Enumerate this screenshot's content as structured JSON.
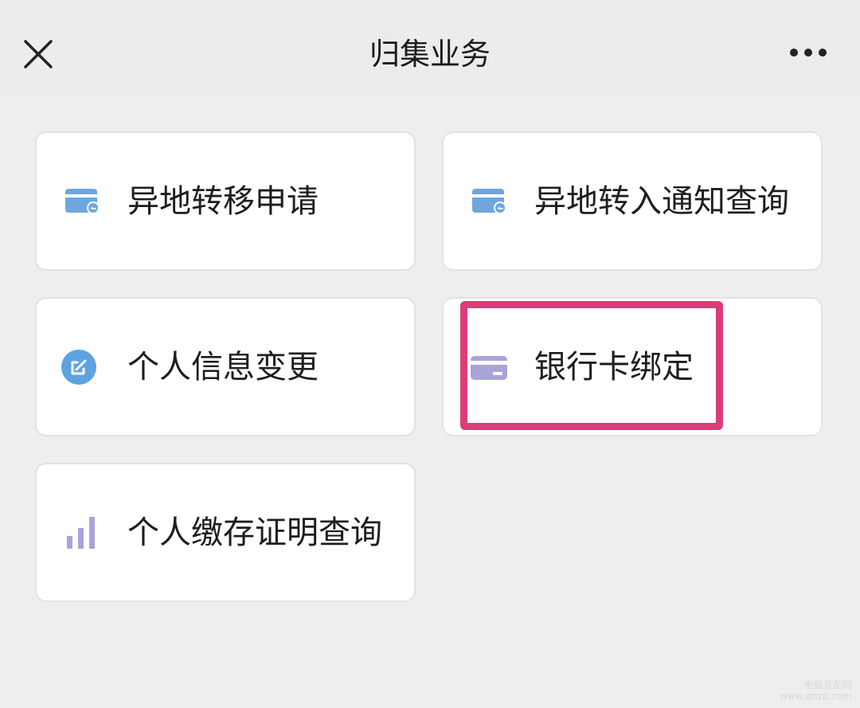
{
  "header": {
    "title": "归集业务",
    "close_icon": "close-icon",
    "more_icon": "more-dots-icon"
  },
  "services": [
    {
      "label": "异地转移申请",
      "icon": "card-transfer-icon",
      "icon_color": "#6fa6dc"
    },
    {
      "label": "异地转入通知查询",
      "icon": "card-transfer-icon",
      "icon_color": "#6fa6dc"
    },
    {
      "label": "个人信息变更",
      "icon": "edit-circle-icon",
      "icon_color": "#5ca3e0"
    },
    {
      "label": "银行卡绑定",
      "icon": "bank-card-icon",
      "icon_color": "#a9a3db"
    },
    {
      "label": "个人缴存证明查询",
      "icon": "bar-chart-icon",
      "icon_color": "#a9a3db"
    }
  ],
  "highlight": {
    "target": "银行卡绑定",
    "color": "#dc3c78"
  },
  "watermark": {
    "line1": "电脑装配网",
    "line2": "www.dnzp.com"
  }
}
